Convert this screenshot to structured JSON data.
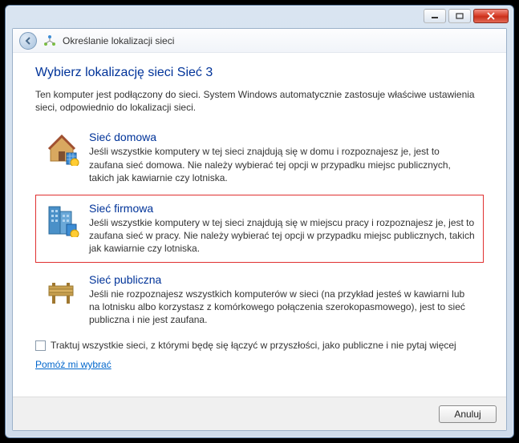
{
  "window": {
    "header_title": "Określanie lokalizacji sieci"
  },
  "content": {
    "instruction": "Wybierz lokalizację sieci Sieć  3",
    "description": "Ten komputer jest podłączony do sieci. System Windows automatycznie zastosuje właściwe ustawienia sieci, odpowiednio do lokalizacji sieci.",
    "options": [
      {
        "title": "Sieć domowa",
        "desc": "Jeśli wszystkie komputery w tej sieci znajdują się w domu i rozpoznajesz je, jest to zaufana sieć domowa. Nie należy wybierać tej opcji w przypadku miejsc publicznych, takich jak kawiarnie czy lotniska."
      },
      {
        "title": "Sieć firmowa",
        "desc": "Jeśli wszystkie komputery w tej sieci znajdują się w miejscu pracy i rozpoznajesz je, jest to zaufana sieć w pracy. Nie należy wybierać tej opcji w przypadku miejsc publicznych, takich jak kawiarnie czy lotniska."
      },
      {
        "title": "Sieć publiczna",
        "desc": "Jeśli nie rozpoznajesz wszystkich komputerów w sieci (na przykład jesteś w kawiarni lub na lotnisku albo korzystasz z komórkowego połączenia szerokopasmowego), jest to sieć publiczna i nie jest zaufana."
      }
    ],
    "checkbox_label": "Traktuj wszystkie sieci, z którymi będę się łączyć w przyszłości, jako publiczne i nie pytaj więcej",
    "help_link": "Pomóż mi wybrać"
  },
  "footer": {
    "cancel": "Anuluj"
  }
}
